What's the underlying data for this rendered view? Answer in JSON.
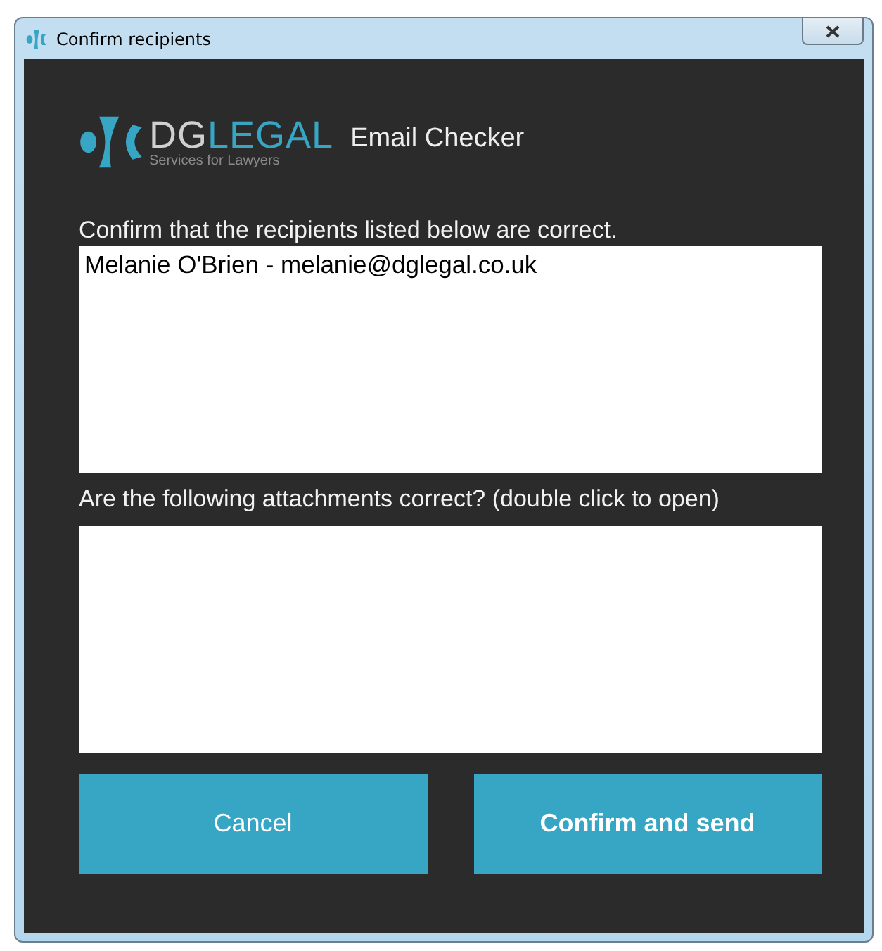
{
  "window": {
    "title": "Confirm recipients"
  },
  "logo": {
    "name_part_1": "DG",
    "name_part_2": "LEGAL",
    "tagline": "Services for Lawyers"
  },
  "app_name": "Email Checker",
  "recipients": {
    "label": "Confirm that the recipients listed below are correct.",
    "items": [
      "Melanie O'Brien - melanie@dglegal.co.uk"
    ]
  },
  "attachments": {
    "label": "Are the following attachments correct? (double click to open)"
  },
  "buttons": [
    {
      "label": "Cancel",
      "kind": "secondary"
    },
    {
      "label": "Confirm and send",
      "kind": "primary"
    }
  ]
}
